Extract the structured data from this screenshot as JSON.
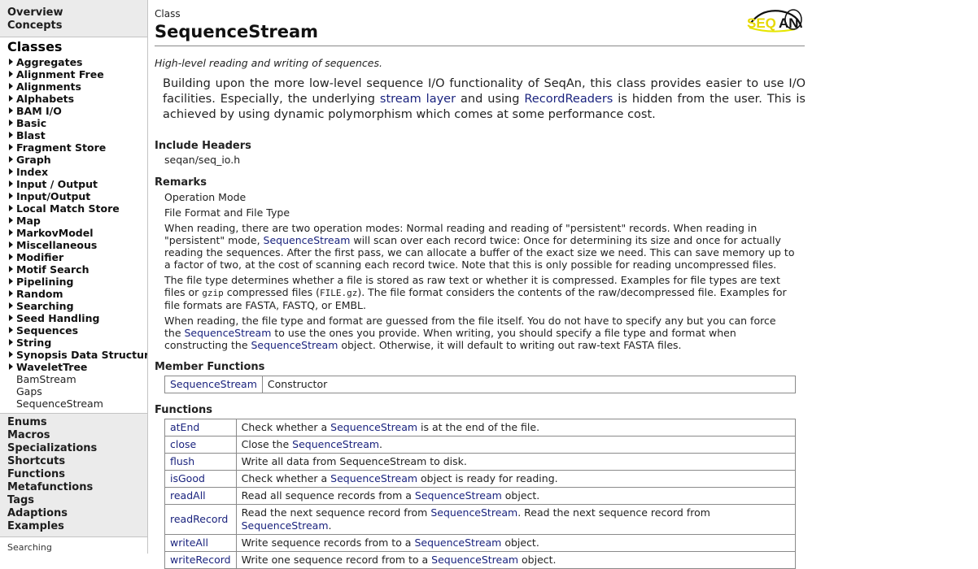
{
  "sidebar": {
    "top_links": [
      "Overview",
      "Concepts"
    ],
    "classes_heading": "Classes",
    "class_groups": [
      "Aggregates",
      "Alignment Free",
      "Alignments",
      "Alphabets",
      "BAM I/O",
      "Basic",
      "Blast",
      "Fragment Store",
      "Graph",
      "Index",
      "Input / Output",
      "Input/Output",
      "Local Match Store",
      "Map",
      "MarkovModel",
      "Miscellaneous",
      "Modifier",
      "Motif Search",
      "Pipelining",
      "Random",
      "Searching",
      "Seed Handling",
      "Sequences",
      "String",
      "Synopsis Data Structure",
      "WaveletTree"
    ],
    "sub_items": [
      "BamStream",
      "Gaps",
      "SequenceStream"
    ],
    "bottom_links": [
      "Enums",
      "Macros",
      "Specializations",
      "Shortcuts",
      "Functions",
      "Metafunctions",
      "Tags",
      "Adaptions",
      "Examples"
    ],
    "footer": "Searching"
  },
  "main": {
    "kind": "Class",
    "title": "SequenceStream",
    "logo_text": "SEQAN",
    "summary": "High-level reading and writing of sequences.",
    "lead": {
      "t1": "Building upon the more low-level sequence I/O functionality of SeqAn, this class provides easier to use I/O facilities. Especially, the underlying ",
      "link1": "stream layer",
      "t2": " and using ",
      "link2": "RecordReaders",
      "t3": " is hidden from the user. This is achieved by using dynamic polymorphism which comes at some performance cost."
    },
    "include_headers": {
      "label": "Include Headers",
      "value": "seqan/seq_io.h"
    },
    "remarks": {
      "label": "Remarks",
      "op_mode": "Operation Mode",
      "file_format": "File Format and File Type",
      "p1": {
        "t1": "When reading, there are two operation modes: Normal reading and reading of \"persistent\" records. When reading in \"persistent\" mode, ",
        "link": "SequenceStream",
        "t2": " will scan over each record twice: Once for determining its size and once for actually reading the sequences. After the first pass, we can allocate a buffer of the exact size we need. This can save memory up to a factor of two, at the cost of scanning each record twice. Note that this is only possible for reading uncompressed files."
      },
      "p2": {
        "t1": "The file type determines whether a file is stored as raw text or whether it is compressed. Examples for file types are text files or ",
        "code1": "gzip",
        "t2": " compressed files (",
        "code2": "FILE.gz",
        "t3": "). The file format considers the contents of the raw/decompressed file. Examples for file formats are FASTA, FASTQ, or EMBL."
      },
      "p3": {
        "t1": "When reading, the file type and format are guessed from the file itself. You do not have to specify any but you can force the ",
        "link1": "SequenceStream",
        "t2": " to use the ones you provide. When writing, you should specify a file type and format when constructing the ",
        "link2": "SequenceStream",
        "t3": " object. Otherwise, it will default to writing out raw-text FASTA files."
      }
    },
    "member_functions": {
      "label": "Member Functions",
      "rows": [
        {
          "name": "SequenceStream",
          "desc": "Constructor"
        }
      ]
    },
    "functions": {
      "label": "Functions",
      "rows": [
        {
          "name": "atEnd",
          "pre": "Check whether a ",
          "link": "SequenceStream",
          "post": " is at the end of the file."
        },
        {
          "name": "close",
          "pre": "Close the ",
          "link": "SequenceStream",
          "post": "."
        },
        {
          "name": "flush",
          "pre": "Write all data from SequenceStream to disk.",
          "link": "",
          "post": ""
        },
        {
          "name": "isGood",
          "pre": "Check whether a ",
          "link": "SequenceStream",
          "post": " object is ready for reading."
        },
        {
          "name": "readAll",
          "pre": "Read all sequence records from a ",
          "link": "SequenceStream",
          "post": " object."
        },
        {
          "name": "readRecord",
          "pre": "Read the next sequence record from ",
          "link": "SequenceStream",
          "post": ". Read the next sequence record from ",
          "link2": "SequenceStream",
          "post2": "."
        },
        {
          "name": "writeAll",
          "pre": "Write sequence records from to a ",
          "link": "SequenceStream",
          "post": " object."
        },
        {
          "name": "writeRecord",
          "pre": "Write one sequence record from to a ",
          "link": "SequenceStream",
          "post": " object."
        }
      ]
    }
  }
}
